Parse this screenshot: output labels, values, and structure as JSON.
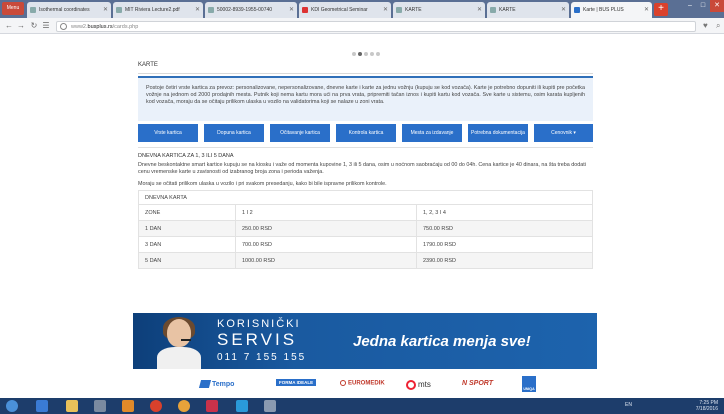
{
  "browser": {
    "menu_label": "Menu",
    "tabs": [
      {
        "label": "Isothermal coordinates",
        "active": false
      },
      {
        "label": "MIT Riviera Lecture2.pdf",
        "active": false
      },
      {
        "label": "50002-8939-1955-00740",
        "active": false
      },
      {
        "label": "KDI Geometrical Seminar",
        "active": false
      },
      {
        "label": "KARTE",
        "active": false
      },
      {
        "label": "KARTE",
        "active": false
      },
      {
        "label": "Karte | BUS PLUS",
        "active": true
      }
    ],
    "new_tab_label": "+",
    "url_prefix": "www2.",
    "url_domain": "busplus.rs",
    "url_path": "/cards.php"
  },
  "page": {
    "heading": "KARTE",
    "intro": "Postoje četiri vrste kartica za prevoz: personalizovane, nepersonalizovane, dnevne karte i karte za jednu vožnju (kupuju se kod vozača). Karte je potrebno dopuniti ili kupiti pre početka vožnje na jednom od 2000 prodajnih mesta. Putnik koji nema kartu mora ući na prva vrata, pripremiti tačan iznos i kupiti kartu kod vozača. Sve karte u sistemu, osim karata kupljenih kod vozača, moraju da se očitaju prilikom ulaska u vozilo na validatorima koji se nalaze u zoni vrata.",
    "nav_buttons": [
      "Vrste kartica",
      "Dopuna kartica",
      "Očitavanje kartica",
      "Kontrola kartica",
      "Mesta za izdavanje",
      "Potrebna dokumentacija",
      "Cenovnik"
    ],
    "section_title": "DNEVNA KARTICA ZA 1, 3 ILI 5 DANA",
    "section_p1": "Dnevne beskontaktne smart kartice kupuju se na kiosku i važe od momenta kupovine 1, 3 ili 5 dana, osim u noćnom saobraćaju od 00 do 04h. Cena kartice je 40 dinara, na šta treba dodati cenu vremenske karte u zavisnosti od izabranog broja zona i perioda važenja.",
    "section_p2": "Moraju se očitati prilikom ulaska u vozilo i pri svakom presedanju, kako bi bile ispravne prilikom kontrole.",
    "table": {
      "caption": "DNEVNA KARTA",
      "headers": [
        "ZONE",
        "1 I 2",
        "1, 2, 3 I 4"
      ],
      "rows": [
        [
          "1 DAN",
          "250.00 RSD",
          "750.00 RSD"
        ],
        [
          "3 DAN",
          "700.00 RSD",
          "1790.00 RSD"
        ],
        [
          "5 DAN",
          "1000.00 RSD",
          "2390.00 RSD"
        ]
      ]
    }
  },
  "banner": {
    "line1": "KORISNIČKI",
    "line2": "SERVIS",
    "phone": "011 7 155 155",
    "slogan": "Jedna kartica menja sve!"
  },
  "partners": [
    {
      "label": "Tempo",
      "color": "#2a6fc9"
    },
    {
      "label": "FORMA IDEALE",
      "color": "#ffffff"
    },
    {
      "label": "EUROMEDIK",
      "color": "#c0392b"
    },
    {
      "label": "mts",
      "color": "#333333"
    },
    {
      "label": "N SPORT",
      "color": "#c0392b"
    },
    {
      "label": "UNIQA",
      "color": "#ffffff"
    }
  ],
  "taskbar": {
    "lang": "EN",
    "time": "7:25 PM",
    "date": "7/18/2016"
  },
  "colors": {
    "accent_blue": "#2a6fc9",
    "banner_blue": "#1a5aa0",
    "taskbar": "#1d3d6b"
  }
}
